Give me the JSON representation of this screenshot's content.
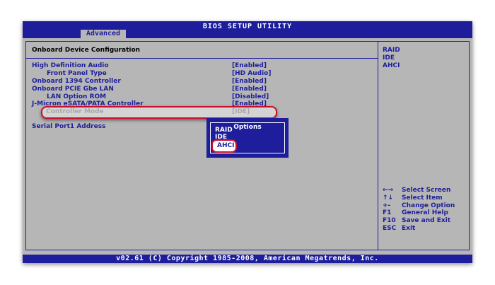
{
  "header": {
    "title": "BIOS SETUP UTILITY",
    "active_tab": "Advanced"
  },
  "main": {
    "heading": "Onboard Device Configuration",
    "items": [
      {
        "label": "High Definition Audio",
        "value": "[Enabled]"
      },
      {
        "label": "Front Panel Type",
        "value": "[HD Audio]"
      },
      {
        "label": "Onboard 1394 Controller",
        "value": "[Enabled]"
      },
      {
        "label": "Onboard PCIE Gbe LAN",
        "value": "[Enabled]"
      },
      {
        "label": "LAN Option ROM",
        "value": "[Disabled]"
      },
      {
        "label": "J-Micron eSATA/PATA Controller",
        "value": "[Enabled]"
      }
    ],
    "highlighted": {
      "label": "Controller Mode",
      "value": "[IDE]"
    },
    "serial": {
      "label": "Serial Port1 Address"
    }
  },
  "popup": {
    "title": "Options",
    "options": [
      "RAID",
      "IDE",
      "AHCI"
    ],
    "selected": "AHCI"
  },
  "help": {
    "options": [
      "RAID",
      "IDE",
      "AHCI"
    ],
    "keys": [
      {
        "key": "←→",
        "desc": "Select Screen"
      },
      {
        "key": "↑↓",
        "desc": "Select Item"
      },
      {
        "key": "+-",
        "desc": "Change Option"
      },
      {
        "key": "F1",
        "desc": "General Help"
      },
      {
        "key": "F10",
        "desc": "Save and Exit"
      },
      {
        "key": "ESC",
        "desc": "Exit"
      }
    ]
  },
  "footer": {
    "copyright": "v02.61 (C) Copyright 1985-2008, American Megatrends, Inc."
  },
  "colors": {
    "bios_blue": "#1e1e9c",
    "bios_gray": "#b6b6b6",
    "highlight_red": "#c8102e"
  }
}
